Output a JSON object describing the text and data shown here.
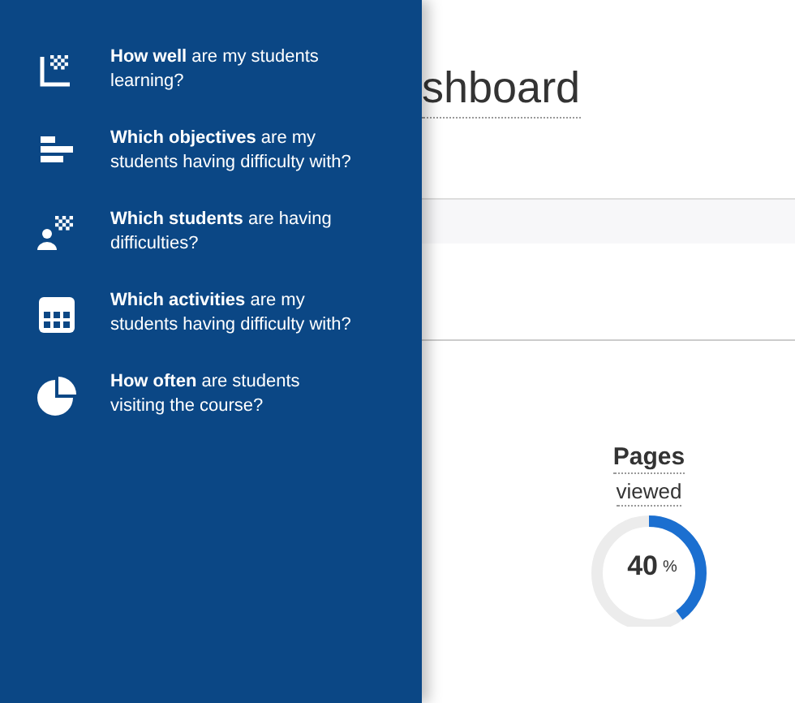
{
  "sidebar": {
    "items": [
      {
        "kind": "learning",
        "label": "**How well** are my students learning?"
      },
      {
        "kind": "objectives",
        "label": "**Which objectives** are my students having difficulty with?"
      },
      {
        "kind": "students",
        "label": "**Which students** are having difficulties?"
      },
      {
        "kind": "activities",
        "label": "**Which activities** are my students having difficulty with?"
      },
      {
        "kind": "visits",
        "label": "**How often** are students visiting the course?"
      }
    ]
  },
  "page": {
    "title": "shboard"
  },
  "metric": {
    "title": "Pages",
    "subtitle": "viewed",
    "value": "40",
    "unit": "%",
    "level": 0.4
  }
}
